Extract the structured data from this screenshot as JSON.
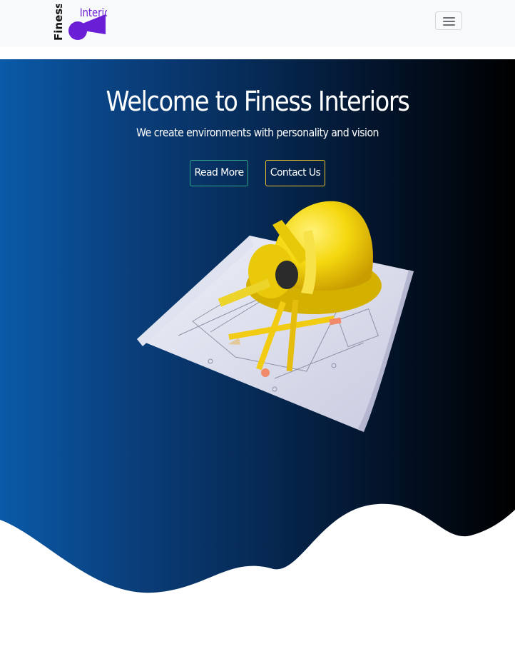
{
  "navbar": {
    "brand": {
      "word1": "Finess",
      "word2": "Interiors"
    },
    "toggler_icon": "hamburger-icon"
  },
  "hero": {
    "title": "Welcome to Finess Interiors",
    "subtitle": "We create environments with personality and vision",
    "buttons": {
      "read_more": "Read More",
      "contact_us": "Contact Us"
    },
    "illustration": "hard-hat-blueprint-illustration"
  },
  "colors": {
    "navbar_bg": "#f8f9fa",
    "hero_gradient_start": "#0a5aa8",
    "hero_gradient_end": "#000000",
    "brand_purple": "#6a1fd6",
    "read_more_border": "#2fa88a",
    "contact_border": "#e6c02e"
  }
}
